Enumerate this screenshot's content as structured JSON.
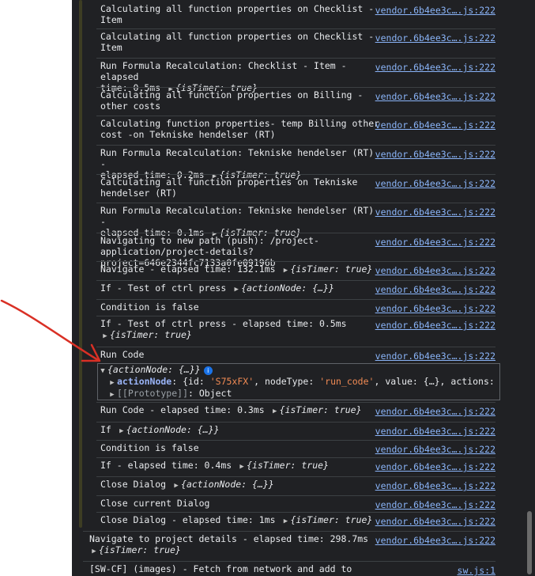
{
  "annotation": {
    "arrow_color": "#d93025"
  },
  "entries": [
    {
      "line1": "Calculating all function properties on Checklist -",
      "line2": "Item",
      "source": "vendor.6b4ee3c….js:222"
    },
    {
      "line1": "Calculating all function properties on Checklist -",
      "line2": "Item",
      "source": "vendor.6b4ee3c….js:222"
    },
    {
      "line1": "Run Formula Recalculation: Checklist - Item - elapsed",
      "line2": "time: 0.5ms",
      "obj": "{isTimer: true}",
      "source": "vendor.6b4ee3c….js:222"
    },
    {
      "line1": "Calculating all function properties on Billing -",
      "line2": "other costs",
      "source": "vendor.6b4ee3c….js:222"
    },
    {
      "line1": "Calculating function properties- temp Billing other",
      "line2": "cost -on Tekniske hendelser (RT)",
      "source": "vendor.6b4ee3c….js:222"
    },
    {
      "line1": "Run Formula Recalculation: Tekniske hendelser (RT) -",
      "line2": "elapsed time: 0.2ms",
      "obj": "{isTimer: true}",
      "source": "vendor.6b4ee3c….js:222"
    },
    {
      "line1": "Calculating all function properties on Tekniske",
      "line2": "hendelser (RT)",
      "source": "vendor.6b4ee3c….js:222"
    },
    {
      "line1": "Run Formula Recalculation: Tekniske hendelser (RT) -",
      "line2": "elapsed time: 0.1ms",
      "obj": "{isTimer: true}",
      "source": "vendor.6b4ee3c….js:222"
    },
    {
      "line1": "Navigating to new path (push): /project-",
      "line2": "application/project-details?project=646e2344fc7133a0fe09196b",
      "source": "vendor.6b4ee3c….js:222"
    },
    {
      "line1": "Navigate - elapsed time: 132.1ms",
      "obj": "{isTimer: true}",
      "source": "vendor.6b4ee3c….js:222"
    },
    {
      "line1": "If - Test of ctrl press",
      "obj": "{actionNode: {…}}",
      "source": "vendor.6b4ee3c….js:222"
    },
    {
      "line1": "Condition is false",
      "source": "vendor.6b4ee3c….js:222"
    },
    {
      "line1": "If - Test of ctrl press - elapsed time: 0.5ms",
      "obj2": "{isTimer: true}",
      "source": "vendor.6b4ee3c….js:222"
    },
    {
      "line1": "Run Code",
      "source": "vendor.6b4ee3c….js:222"
    },
    {
      "line1": "Run Code - elapsed time: 0.3ms",
      "obj": "{isTimer: true}",
      "source": "vendor.6b4ee3c….js:222"
    },
    {
      "line1": "If",
      "obj": "{actionNode: {…}}",
      "source": "vendor.6b4ee3c….js:222"
    },
    {
      "line1": "Condition is false",
      "source": "vendor.6b4ee3c….js:222"
    },
    {
      "line1": "If - elapsed time: 0.4ms",
      "obj": "{isTimer: true}",
      "source": "vendor.6b4ee3c….js:222"
    },
    {
      "line1": "Close Dialog",
      "obj": "{actionNode: {…}}",
      "source": "vendor.6b4ee3c….js:222"
    },
    {
      "line1": "Close current Dialog",
      "source": "vendor.6b4ee3c….js:222"
    },
    {
      "line1": "Close Dialog - elapsed time: 1ms",
      "obj": "{isTimer: true}",
      "source": "vendor.6b4ee3c….js:222"
    },
    {
      "line1": "Navigate to project details - elapsed time: 298.7ms",
      "obj2": "{isTimer: true}",
      "source": "vendor.6b4ee3c….js:222"
    },
    {
      "line1": "[SW-CF] (images) - Fetch from network and add to cache:",
      "source": "sw.js:1"
    }
  ],
  "expanded": {
    "summary": "{actionNode: {…}}",
    "info": "i",
    "prop_key": "actionNode",
    "prop_val_open": "{id: ",
    "prop_id": "'S75xFX'",
    "prop_mid": ", nodeType: ",
    "prop_type": "'run_code'",
    "prop_rest": ", value: {…}, actions: Arr",
    "proto_key": "[[Prototype]]",
    "proto_val": ": Object"
  }
}
